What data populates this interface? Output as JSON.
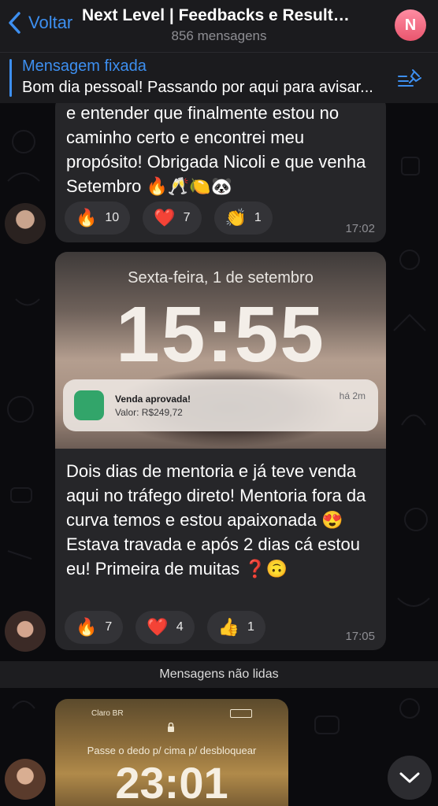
{
  "header": {
    "back_label": "Voltar",
    "title": "Next Level | Feedbacks e Resultados",
    "subtitle": "856 mensagens",
    "avatar_letter": "N"
  },
  "pinned": {
    "title": "Mensagem fixada",
    "text": "Bom dia pessoal! Passando por aqui para avisar..."
  },
  "messages": [
    {
      "text": "e entender que finalmente estou no caminho certo e encontrei meu propósito! Obrigada Nicoli e que venha Setembro 🔥🥂🍋🐼",
      "reactions": [
        {
          "emoji": "🔥",
          "count": "10"
        },
        {
          "emoji": "❤️",
          "count": "7"
        },
        {
          "emoji": "👏",
          "count": "1"
        }
      ],
      "time": "17:02"
    },
    {
      "photo": {
        "date": "Sexta-feira, 1 de setembro",
        "time": "15:55",
        "notification_title": "Venda aprovada!",
        "notification_value": "Valor: R$249,72",
        "notification_time": "há 2m"
      },
      "text": "Dois dias de mentoria e já teve venda aqui no tráfego direto! Mentoria fora da curva temos e estou apaixonada 😍 Estava travada e após 2 dias cá estou eu! Primeira de muitas ❓🙃",
      "reactions": [
        {
          "emoji": "🔥",
          "count": "7"
        },
        {
          "emoji": "❤️",
          "count": "4"
        },
        {
          "emoji": "👍",
          "count": "1"
        }
      ],
      "time": "17:05"
    }
  ],
  "unread_label": "Mensagens não lidas",
  "photo2": {
    "carrier": "Claro BR",
    "hint": "Passe o dedo p/ cima p/ desbloquear",
    "time": "23:01"
  },
  "colors": {
    "accent": "#3d8ff0",
    "bubble": "#262629",
    "header": "#1b1b1e"
  }
}
